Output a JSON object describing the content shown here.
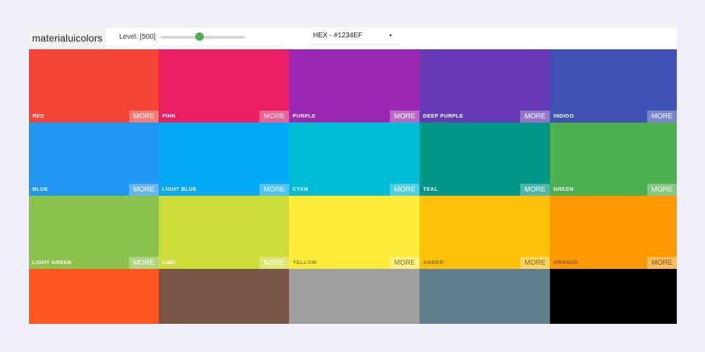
{
  "brand": {
    "title": "materialuicolors"
  },
  "level": {
    "label": "Level: [500]",
    "fraction": 0.46
  },
  "format": {
    "value": "HEX - #1234EF",
    "icon": "chevron-down-icon"
  },
  "tiles": [
    {
      "name": "RED",
      "color": "#f44336",
      "more": "MORE",
      "light": false
    },
    {
      "name": "PINK",
      "color": "#e91e63",
      "more": "MORE",
      "light": false
    },
    {
      "name": "PURPLE",
      "color": "#9c27b0",
      "more": "MORE",
      "light": false
    },
    {
      "name": "DEEP PURPLE",
      "color": "#673ab7",
      "more": "MORE",
      "light": false
    },
    {
      "name": "INDIGO",
      "color": "#3f51b5",
      "more": "MORE",
      "light": false
    },
    {
      "name": "BLUE",
      "color": "#2196f3",
      "more": "MORE",
      "light": false
    },
    {
      "name": "LIGHT BLUE",
      "color": "#03a9f4",
      "more": "MORE",
      "light": false
    },
    {
      "name": "CYAN",
      "color": "#00bcd4",
      "more": "MORE",
      "light": false
    },
    {
      "name": "TEAL",
      "color": "#009688",
      "more": "MORE",
      "light": false
    },
    {
      "name": "GREEN",
      "color": "#4caf50",
      "more": "MORE",
      "light": false
    },
    {
      "name": "LIGHT GREEN",
      "color": "#8bc34a",
      "more": "MORE",
      "light": false
    },
    {
      "name": "LIME",
      "color": "#cddc39",
      "more": "MORE",
      "light": false
    },
    {
      "name": "YELLOW",
      "color": "#ffeb3b",
      "more": "MORE",
      "light": true
    },
    {
      "name": "AMBER",
      "color": "#ffc107",
      "more": "MORE",
      "light": true
    },
    {
      "name": "ORANGE",
      "color": "#ff9800",
      "more": "MORE",
      "light": true
    },
    {
      "name": "",
      "color": "#ff5722",
      "more": "",
      "light": false
    },
    {
      "name": "",
      "color": "#795548",
      "more": "",
      "light": false
    },
    {
      "name": "",
      "color": "#9e9e9e",
      "more": "",
      "light": false
    },
    {
      "name": "",
      "color": "#607d8b",
      "more": "",
      "light": false
    },
    {
      "name": "",
      "color": "#000000",
      "more": "",
      "light": false
    }
  ]
}
